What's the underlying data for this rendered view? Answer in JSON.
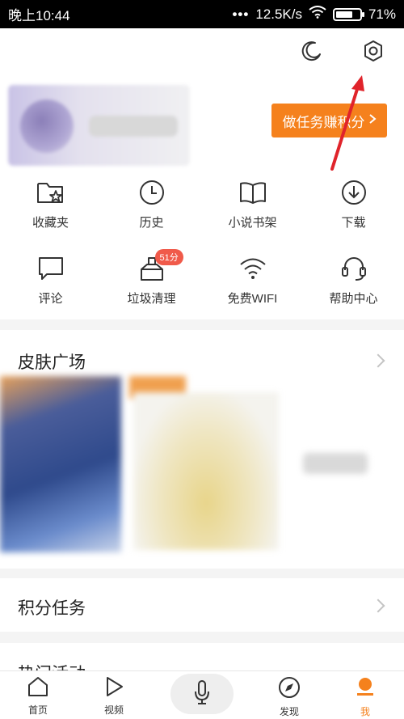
{
  "status_bar": {
    "time": "晚上10:44",
    "network_speed": "12.5K/s",
    "battery_percent": "71%",
    "battery_level": 0.71
  },
  "header": {
    "task_button_label": "做任务赚积分"
  },
  "shortcuts_row1": [
    {
      "label": "收藏夹",
      "icon": "folder-star-icon"
    },
    {
      "label": "历史",
      "icon": "clock-icon"
    },
    {
      "label": "小说书架",
      "icon": "book-icon"
    },
    {
      "label": "下载",
      "icon": "download-icon"
    }
  ],
  "shortcuts_row2": [
    {
      "label": "评论",
      "icon": "comment-icon"
    },
    {
      "label": "垃圾清理",
      "icon": "brush-icon",
      "badge": "51分"
    },
    {
      "label": "免费WIFI",
      "icon": "wifi-icon"
    },
    {
      "label": "帮助中心",
      "icon": "headset-icon"
    }
  ],
  "sections": {
    "skin_title": "皮肤广场",
    "points_title": "积分任务",
    "hot_title": "热门活动"
  },
  "tabbar": {
    "items": [
      {
        "label": "首页",
        "icon": "home-icon"
      },
      {
        "label": "视频",
        "icon": "play-icon"
      },
      {
        "label": "",
        "icon": "microphone-icon"
      },
      {
        "label": "发现",
        "icon": "compass-icon"
      },
      {
        "label": "我",
        "icon": "me-icon"
      }
    ],
    "active": "我"
  },
  "colors": {
    "accent": "#f5811d",
    "badge": "#f05a4a",
    "arrow": "#e0242b"
  }
}
